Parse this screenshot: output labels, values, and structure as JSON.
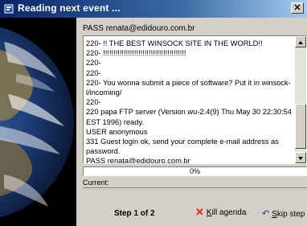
{
  "window": {
    "title": "Reading next event ..."
  },
  "pass_line": "PASS renata@edidouro.com.br",
  "log_lines": [
    "220-        !! THE BEST WINSOCK SITE IN THE WORLD!!",
    "220-        !!!!!!!!!!!!!!!!!!!!!!!!!!!!!!!!!!!!!!!!",
    "220-",
    "220-",
    "220-  You wonna submit a piece of software? Put it in winsock-l/incoming/",
    "220-",
    "220 papa FTP server (Version wu-2.4(9) Thu May 30 22:30:54 EST 1996) ready.",
    "USER anonymous",
    "331 Guest login ok, send your complete e-mail address as password.",
    "PASS renata@edidouro.com.br"
  ],
  "progress": {
    "label": "0%",
    "value": 0
  },
  "current": {
    "label": "Current:",
    "value": ""
  },
  "step": "Step 1 of 2",
  "kill_button": {
    "label_first": "K",
    "label_rest": "ill agenda"
  },
  "skip_button": {
    "label_first": "S",
    "label_rest": "kip step"
  }
}
